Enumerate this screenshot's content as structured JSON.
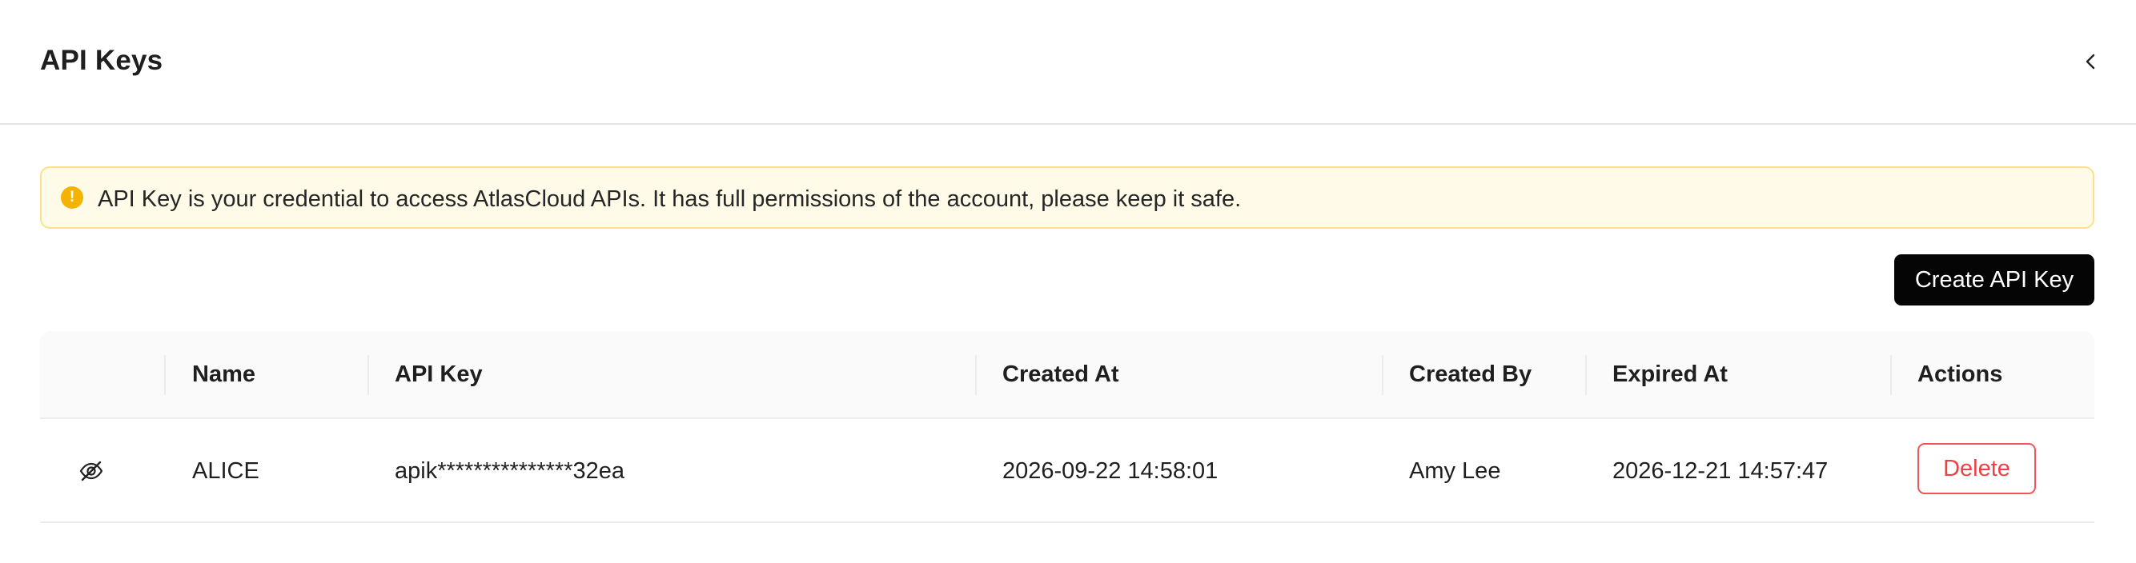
{
  "header": {
    "title": "API Keys",
    "collapse_icon": "chevron-left-icon"
  },
  "notice": {
    "icon": "warning-circle-icon",
    "text": "API Key is your credential to access AtlasCloud APIs. It has full permissions of the account, please keep it safe.",
    "background_color": "#fffbe8",
    "border_color": "#fbe28a",
    "icon_color": "#f5b301"
  },
  "toolbar": {
    "create_label": "Create API Key",
    "create_color": "#050505"
  },
  "table": {
    "columns": [
      "",
      "Name",
      "API Key",
      "Created At",
      "Created By",
      "Expired At",
      "Actions"
    ],
    "rows": [
      {
        "visibility_icon": "eye-off-icon",
        "name": "ALICE",
        "api_key": "apik***************32ea",
        "created_at": "2026-09-22 14:58:01",
        "created_by": "Amy Lee",
        "expired_at": "2026-12-21 14:57:47",
        "action_label": "Delete"
      }
    ]
  },
  "colors": {
    "danger": "#ee4048",
    "header_bg": "#fafafa",
    "divider": "#ececec"
  }
}
